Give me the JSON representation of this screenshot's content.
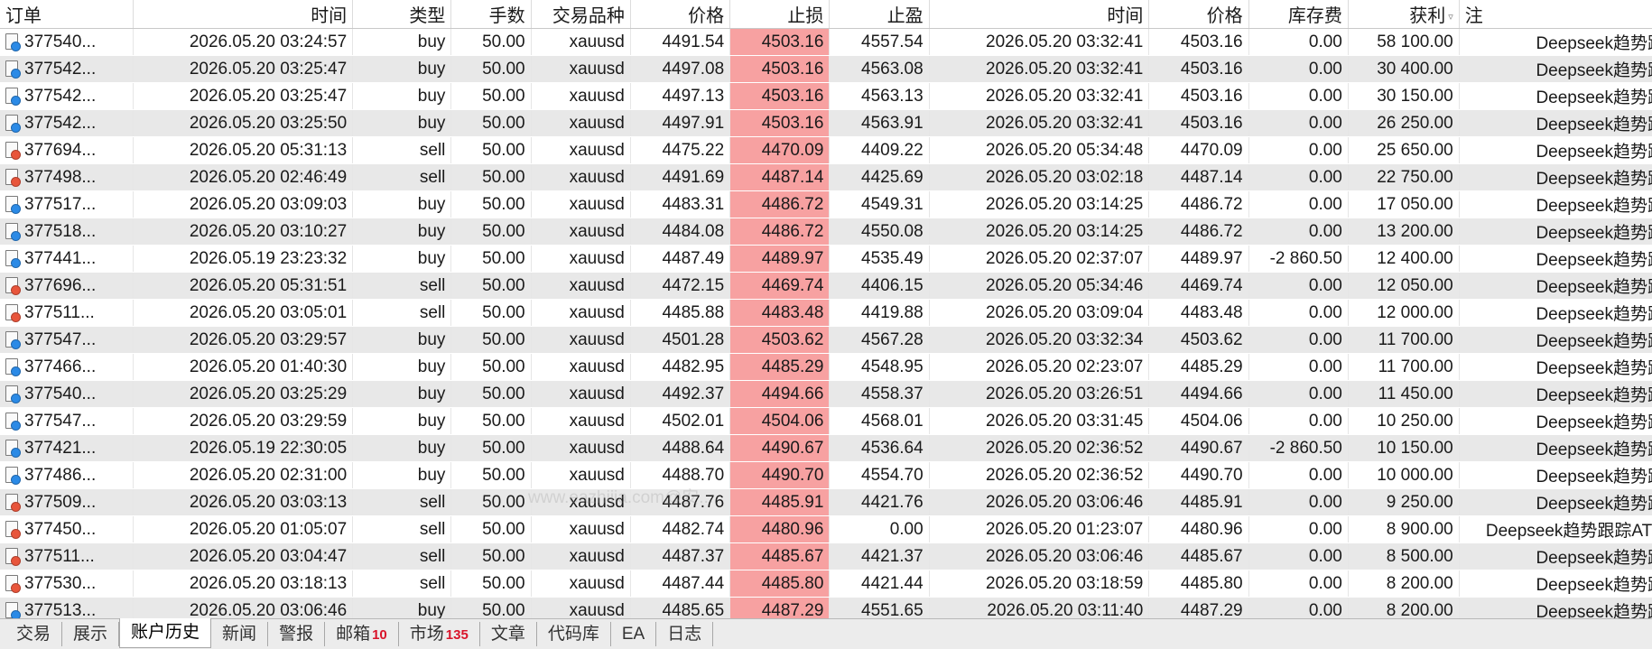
{
  "columns": [
    "订单",
    "时间",
    "类型",
    "手数",
    "交易品种",
    "价格",
    "止损",
    "止盈",
    "时间",
    "价格",
    "库存费",
    "获利",
    "注"
  ],
  "rows": [
    {
      "ticket": "377540...",
      "open_time": "2026.05.20 03:24:57",
      "type": "buy",
      "volume": "50.00",
      "symbol": "xauusd",
      "open_price": "4491.54",
      "sl": "4503.16",
      "tp": "4557.54",
      "close_time": "2026.05.20 03:32:41",
      "close_price": "4503.16",
      "swap": "0.00",
      "profit": "58 100.00",
      "comment": "Deepseek趋势跟踪"
    },
    {
      "ticket": "377542...",
      "open_time": "2026.05.20 03:25:47",
      "type": "buy",
      "volume": "50.00",
      "symbol": "xauusd",
      "open_price": "4497.08",
      "sl": "4503.16",
      "tp": "4563.08",
      "close_time": "2026.05.20 03:32:41",
      "close_price": "4503.16",
      "swap": "0.00",
      "profit": "30 400.00",
      "comment": "Deepseek趋势跟踪"
    },
    {
      "ticket": "377542...",
      "open_time": "2026.05.20 03:25:47",
      "type": "buy",
      "volume": "50.00",
      "symbol": "xauusd",
      "open_price": "4497.13",
      "sl": "4503.16",
      "tp": "4563.13",
      "close_time": "2026.05.20 03:32:41",
      "close_price": "4503.16",
      "swap": "0.00",
      "profit": "30 150.00",
      "comment": "Deepseek趋势跟踪"
    },
    {
      "ticket": "377542...",
      "open_time": "2026.05.20 03:25:50",
      "type": "buy",
      "volume": "50.00",
      "symbol": "xauusd",
      "open_price": "4497.91",
      "sl": "4503.16",
      "tp": "4563.91",
      "close_time": "2026.05.20 03:32:41",
      "close_price": "4503.16",
      "swap": "0.00",
      "profit": "26 250.00",
      "comment": "Deepseek趋势跟踪"
    },
    {
      "ticket": "377694...",
      "open_time": "2026.05.20 05:31:13",
      "type": "sell",
      "volume": "50.00",
      "symbol": "xauusd",
      "open_price": "4475.22",
      "sl": "4470.09",
      "tp": "4409.22",
      "close_time": "2026.05.20 05:34:48",
      "close_price": "4470.09",
      "swap": "0.00",
      "profit": "25 650.00",
      "comment": "Deepseek趋势跟踪"
    },
    {
      "ticket": "377498...",
      "open_time": "2026.05.20 02:46:49",
      "type": "sell",
      "volume": "50.00",
      "symbol": "xauusd",
      "open_price": "4491.69",
      "sl": "4487.14",
      "tp": "4425.69",
      "close_time": "2026.05.20 03:02:18",
      "close_price": "4487.14",
      "swap": "0.00",
      "profit": "22 750.00",
      "comment": "Deepseek趋势跟踪"
    },
    {
      "ticket": "377517...",
      "open_time": "2026.05.20 03:09:03",
      "type": "buy",
      "volume": "50.00",
      "symbol": "xauusd",
      "open_price": "4483.31",
      "sl": "4486.72",
      "tp": "4549.31",
      "close_time": "2026.05.20 03:14:25",
      "close_price": "4486.72",
      "swap": "0.00",
      "profit": "17 050.00",
      "comment": "Deepseek趋势跟踪"
    },
    {
      "ticket": "377518...",
      "open_time": "2026.05.20 03:10:27",
      "type": "buy",
      "volume": "50.00",
      "symbol": "xauusd",
      "open_price": "4484.08",
      "sl": "4486.72",
      "tp": "4550.08",
      "close_time": "2026.05.20 03:14:25",
      "close_price": "4486.72",
      "swap": "0.00",
      "profit": "13 200.00",
      "comment": "Deepseek趋势跟踪"
    },
    {
      "ticket": "377441...",
      "open_time": "2026.05.19 23:23:32",
      "type": "buy",
      "volume": "50.00",
      "symbol": "xauusd",
      "open_price": "4487.49",
      "sl": "4489.97",
      "tp": "4535.49",
      "close_time": "2026.05.20 02:37:07",
      "close_price": "4489.97",
      "swap": "-2 860.50",
      "profit": "12 400.00",
      "comment": "Deepseek趋势跟踪"
    },
    {
      "ticket": "377696...",
      "open_time": "2026.05.20 05:31:51",
      "type": "sell",
      "volume": "50.00",
      "symbol": "xauusd",
      "open_price": "4472.15",
      "sl": "4469.74",
      "tp": "4406.15",
      "close_time": "2026.05.20 05:34:46",
      "close_price": "4469.74",
      "swap": "0.00",
      "profit": "12 050.00",
      "comment": "Deepseek趋势跟踪"
    },
    {
      "ticket": "377511...",
      "open_time": "2026.05.20 03:05:01",
      "type": "sell",
      "volume": "50.00",
      "symbol": "xauusd",
      "open_price": "4485.88",
      "sl": "4483.48",
      "tp": "4419.88",
      "close_time": "2026.05.20 03:09:04",
      "close_price": "4483.48",
      "swap": "0.00",
      "profit": "12 000.00",
      "comment": "Deepseek趋势跟踪"
    },
    {
      "ticket": "377547...",
      "open_time": "2026.05.20 03:29:57",
      "type": "buy",
      "volume": "50.00",
      "symbol": "xauusd",
      "open_price": "4501.28",
      "sl": "4503.62",
      "tp": "4567.28",
      "close_time": "2026.05.20 03:32:34",
      "close_price": "4503.62",
      "swap": "0.00",
      "profit": "11 700.00",
      "comment": "Deepseek趋势跟踪"
    },
    {
      "ticket": "377466...",
      "open_time": "2026.05.20 01:40:30",
      "type": "buy",
      "volume": "50.00",
      "symbol": "xauusd",
      "open_price": "4482.95",
      "sl": "4485.29",
      "tp": "4548.95",
      "close_time": "2026.05.20 02:23:07",
      "close_price": "4485.29",
      "swap": "0.00",
      "profit": "11 700.00",
      "comment": "Deepseek趋势跟踪"
    },
    {
      "ticket": "377540...",
      "open_time": "2026.05.20 03:25:29",
      "type": "buy",
      "volume": "50.00",
      "symbol": "xauusd",
      "open_price": "4492.37",
      "sl": "4494.66",
      "tp": "4558.37",
      "close_time": "2026.05.20 03:26:51",
      "close_price": "4494.66",
      "swap": "0.00",
      "profit": "11 450.00",
      "comment": "Deepseek趋势跟踪"
    },
    {
      "ticket": "377547...",
      "open_time": "2026.05.20 03:29:59",
      "type": "buy",
      "volume": "50.00",
      "symbol": "xauusd",
      "open_price": "4502.01",
      "sl": "4504.06",
      "tp": "4568.01",
      "close_time": "2026.05.20 03:31:45",
      "close_price": "4504.06",
      "swap": "0.00",
      "profit": "10 250.00",
      "comment": "Deepseek趋势跟踪"
    },
    {
      "ticket": "377421...",
      "open_time": "2026.05.19 22:30:05",
      "type": "buy",
      "volume": "50.00",
      "symbol": "xauusd",
      "open_price": "4488.64",
      "sl": "4490.67",
      "tp": "4536.64",
      "close_time": "2026.05.20 02:36:52",
      "close_price": "4490.67",
      "swap": "-2 860.50",
      "profit": "10 150.00",
      "comment": "Deepseek趋势跟踪"
    },
    {
      "ticket": "377486...",
      "open_time": "2026.05.20 02:31:00",
      "type": "buy",
      "volume": "50.00",
      "symbol": "xauusd",
      "open_price": "4488.70",
      "sl": "4490.70",
      "tp": "4554.70",
      "close_time": "2026.05.20 02:36:52",
      "close_price": "4490.70",
      "swap": "0.00",
      "profit": "10 000.00",
      "comment": "Deepseek趋势跟踪"
    },
    {
      "ticket": "377509...",
      "open_time": "2026.05.20 03:03:13",
      "type": "sell",
      "volume": "50.00",
      "symbol": "xauusd",
      "open_price": "4487.76",
      "sl": "4485.91",
      "tp": "4421.76",
      "close_time": "2026.05.20 03:06:46",
      "close_price": "4485.91",
      "swap": "0.00",
      "profit": "9 250.00",
      "comment": "Deepseek趋势跟踪"
    },
    {
      "ticket": "377450...",
      "open_time": "2026.05.20 01:05:07",
      "type": "sell",
      "volume": "50.00",
      "symbol": "xauusd",
      "open_price": "4482.74",
      "sl": "4480.96",
      "tp": "0.00",
      "close_time": "2026.05.20 01:23:07",
      "close_price": "4480.96",
      "swap": "0.00",
      "profit": "8 900.00",
      "comment": "Deepseek趋势跟踪ATR版"
    },
    {
      "ticket": "377511...",
      "open_time": "2026.05.20 03:04:47",
      "type": "sell",
      "volume": "50.00",
      "symbol": "xauusd",
      "open_price": "4487.37",
      "sl": "4485.67",
      "tp": "4421.37",
      "close_time": "2026.05.20 03:06:46",
      "close_price": "4485.67",
      "swap": "0.00",
      "profit": "8 500.00",
      "comment": "Deepseek趋势跟踪"
    },
    {
      "ticket": "377530...",
      "open_time": "2026.05.20 03:18:13",
      "type": "sell",
      "volume": "50.00",
      "symbol": "xauusd",
      "open_price": "4487.44",
      "sl": "4485.80",
      "tp": "4421.44",
      "close_time": "2026.05.20 03:18:59",
      "close_price": "4485.80",
      "swap": "0.00",
      "profit": "8 200.00",
      "comment": "Deepseek趋势跟踪"
    },
    {
      "ticket": "377513...",
      "open_time": "2026.05.20 03:06:46",
      "type": "buy",
      "volume": "50.00",
      "symbol": "xauusd",
      "open_price": "4485.65",
      "sl": "4487.29",
      "tp": "4551.65",
      "close_time": "2026.05.20 03:11:40",
      "close_price": "4487.29",
      "swap": "0.00",
      "profit": "8 200.00",
      "comment": "Deepseek趋势跟踪"
    }
  ],
  "tabs": [
    {
      "label": "交易",
      "badge": ""
    },
    {
      "label": "展示",
      "badge": ""
    },
    {
      "label": "账户历史",
      "badge": "",
      "active": true
    },
    {
      "label": "新闻",
      "badge": ""
    },
    {
      "label": "警报",
      "badge": ""
    },
    {
      "label": "邮箱",
      "badge": "10"
    },
    {
      "label": "市场",
      "badge": "135"
    },
    {
      "label": "文章",
      "badge": ""
    },
    {
      "label": "代码库",
      "badge": ""
    },
    {
      "label": "EA",
      "badge": ""
    },
    {
      "label": "日志",
      "badge": ""
    }
  ],
  "colors": {
    "stoploss_highlight": "#f7a1a1",
    "badge": "#d9142a",
    "buy_icon": "#2b8ae6",
    "sell_icon": "#e8553b"
  },
  "watermark": "www.eazhijia.com@安..."
}
